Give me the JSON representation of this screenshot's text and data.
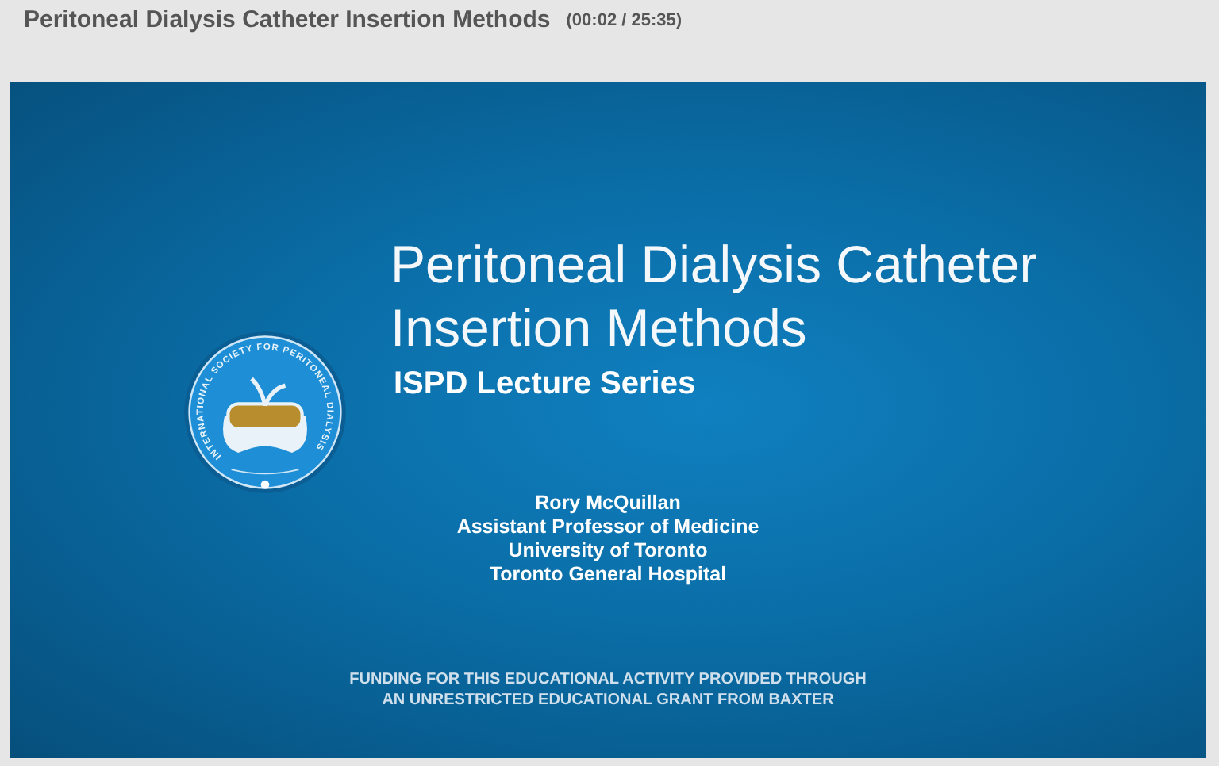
{
  "header": {
    "title": "Peritoneal Dialysis Catheter Insertion Methods",
    "time": "(00:02 / 25:35)"
  },
  "slide": {
    "logo_text": "INTERNATIONAL SOCIETY FOR PERITONEAL DIALYSIS",
    "title_lines": [
      "Peritoneal Dialysis Catheter",
      "Insertion Methods"
    ],
    "subtitle": "ISPD Lecture Series",
    "presenter": [
      "Rory McQuillan",
      "Assistant Professor of Medicine",
      "University of Toronto",
      "Toronto General Hospital"
    ],
    "funding": [
      "FUNDING FOR THIS EDUCATIONAL ACTIVITY PROVIDED THROUGH",
      "AN UNRESTRICTED EDUCATIONAL GRANT FROM BAXTER"
    ]
  }
}
